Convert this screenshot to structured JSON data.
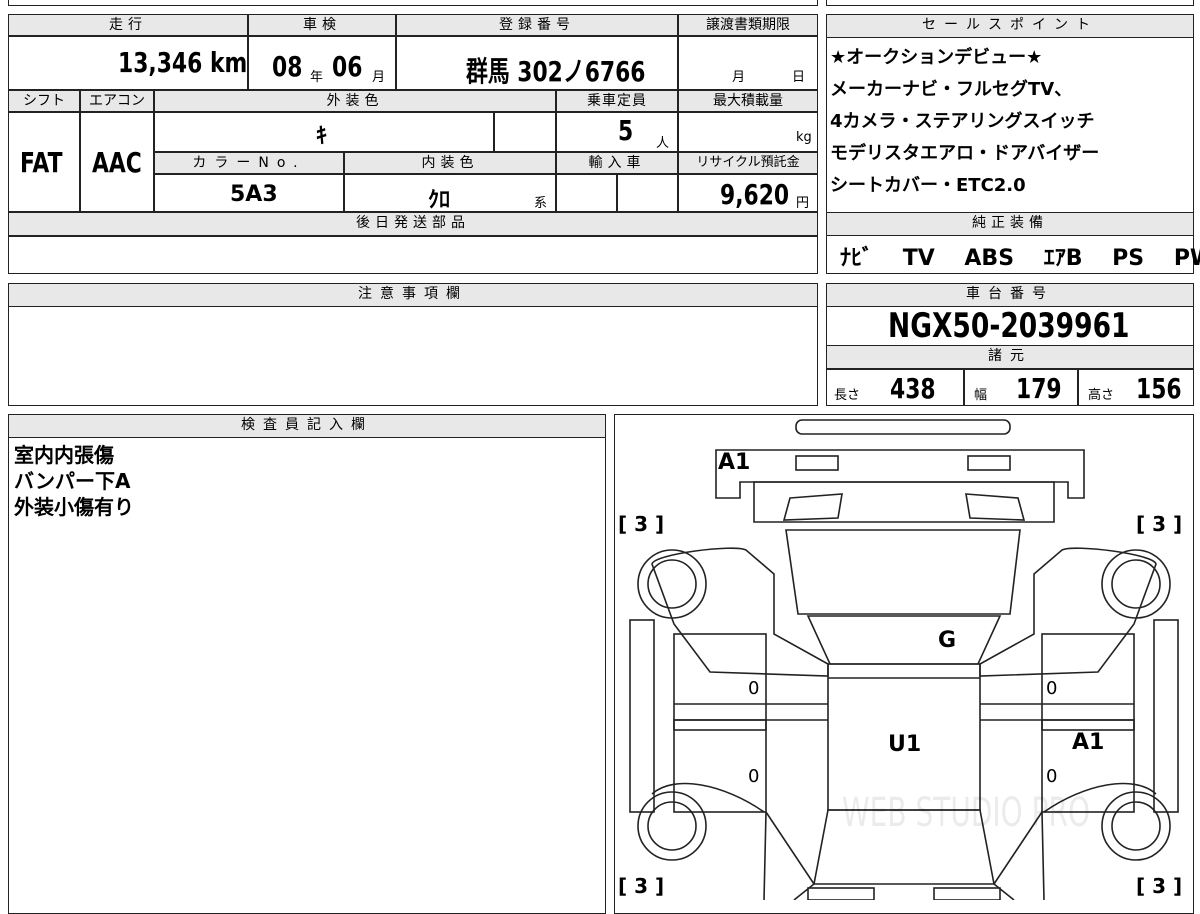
{
  "headers": {
    "mileage": "走行",
    "inspection": "車検",
    "reg_number": "登録番号",
    "transfer_deadline": "譲渡書類期限",
    "sales_points": "セールスポイント",
    "shift": "シフト",
    "aircon": "エアコン",
    "exterior_color": "外装色",
    "capacity": "乗車定員",
    "max_load": "最大積載量",
    "color_no": "カラーNo.",
    "interior_color": "内装色",
    "import": "輸入車",
    "recycle": "リサイクル預託金",
    "later_parts": "後日発送部品",
    "genuine_equipment": "純正装備",
    "caution": "注意事項欄",
    "chassis": "車台番号",
    "specs": "諸元",
    "inspector": "検査員記入欄"
  },
  "vehicle": {
    "mileage_value": "13,346",
    "mileage_unit": "km",
    "inspection_year": "08",
    "inspection_year_unit": "年",
    "inspection_month": "06",
    "inspection_month_unit": "月",
    "reg_number": "群馬 302ノ6766",
    "deadline_month_unit": "月",
    "deadline_day_unit": "日",
    "shift": "FAT",
    "aircon": "AAC",
    "exterior_color": "ｷ",
    "capacity": "5",
    "capacity_unit": "人",
    "max_load_unit": "kg",
    "color_no": "5A3",
    "interior_color": "ｸﾛ",
    "interior_color_unit": "系",
    "recycle_fee": "9,620",
    "recycle_unit": "円",
    "chassis_number": "NGX50-2039961"
  },
  "sales_points": [
    "★オークションデビュー★",
    "メーカーナビ・フルセグTV、",
    "4カメラ・ステアリングスイッチ",
    "モデリスタエアロ・ドアバイザー",
    "シートカバー・ETC2.0"
  ],
  "equipment": [
    "ﾅﾋﾞ",
    "TV",
    "ABS",
    "ｴｱB",
    "PS",
    "PW"
  ],
  "specs": {
    "length_label": "長さ",
    "length": "438",
    "width_label": "幅",
    "width": "179",
    "height_label": "高さ",
    "height": "156"
  },
  "inspector_notes": [
    "室内内張傷",
    "バンパー下A",
    "外装小傷有り"
  ],
  "diagram": {
    "marks": {
      "front": "A1",
      "hood": "G",
      "roof": "U1",
      "right_door": "A1",
      "left_front_door": "0",
      "left_rear_door": "0",
      "right_front_door": "0",
      "right_rear_door": "0"
    },
    "tire_marks": {
      "front_left": "[ 3 ]",
      "front_right": "[ 3 ]",
      "rear_left": "[ 3 ]",
      "rear_right": "[ 3 ]"
    },
    "watermark": "WEB STUDIO PRO"
  }
}
